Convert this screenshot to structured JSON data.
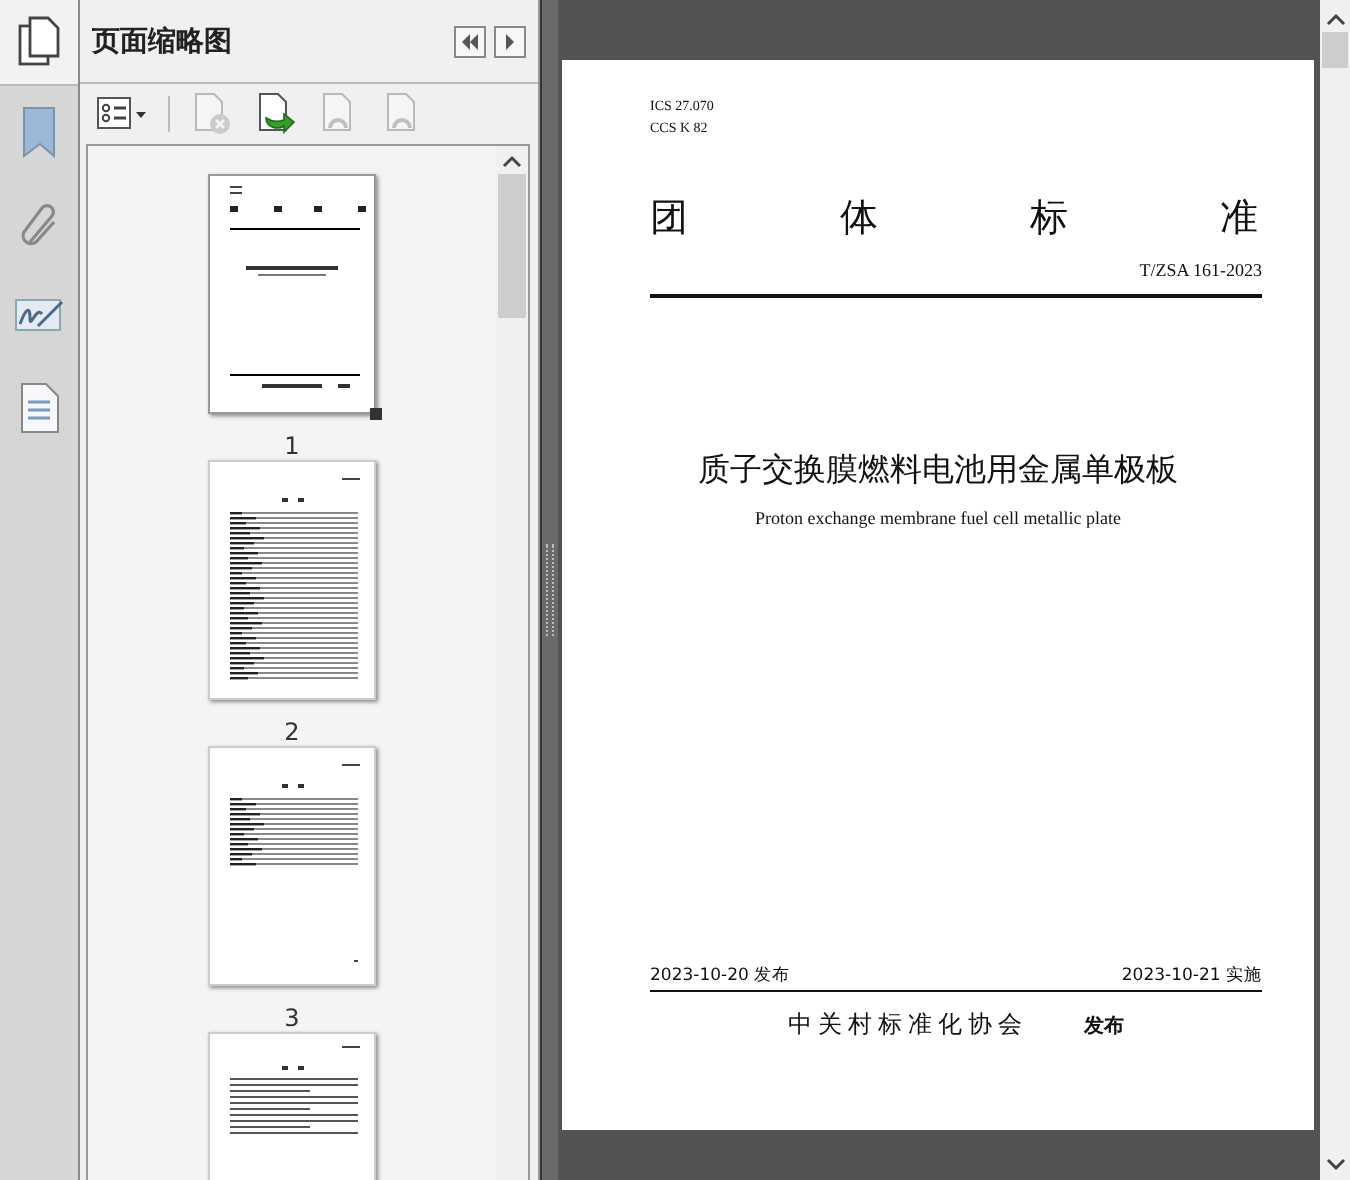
{
  "panel": {
    "title": "页面缩略图"
  },
  "toolbar": [
    {
      "kind": "options",
      "disabled": false
    },
    {
      "kind": "delete",
      "disabled": true
    },
    {
      "kind": "insert",
      "disabled": false
    },
    {
      "kind": "undo",
      "disabled": true
    },
    {
      "kind": "redo",
      "disabled": true
    }
  ],
  "thumbnails": [
    {
      "kind": "cover",
      "label": "1",
      "selected": true
    },
    {
      "kind": "contents",
      "label": "2",
      "selected": false
    },
    {
      "kind": "contents-short",
      "label": "3",
      "selected": false
    },
    {
      "kind": "text",
      "selected": false
    }
  ],
  "document": {
    "ics": "ICS  27.070",
    "ccs": "CCS K 82",
    "heading": [
      "团",
      "体",
      "标",
      "准"
    ],
    "code": "T/ZSA 161-2023",
    "title": "质子交换膜燃料电池用金属单极板",
    "subtitle": "Proton exchange membrane fuel cell metallic plate",
    "publish_date": "2023-10-20 发布",
    "effective_date": "2023-10-21 实施",
    "publisher": "中关村标准化协会",
    "publisher_suffix": "发布"
  }
}
